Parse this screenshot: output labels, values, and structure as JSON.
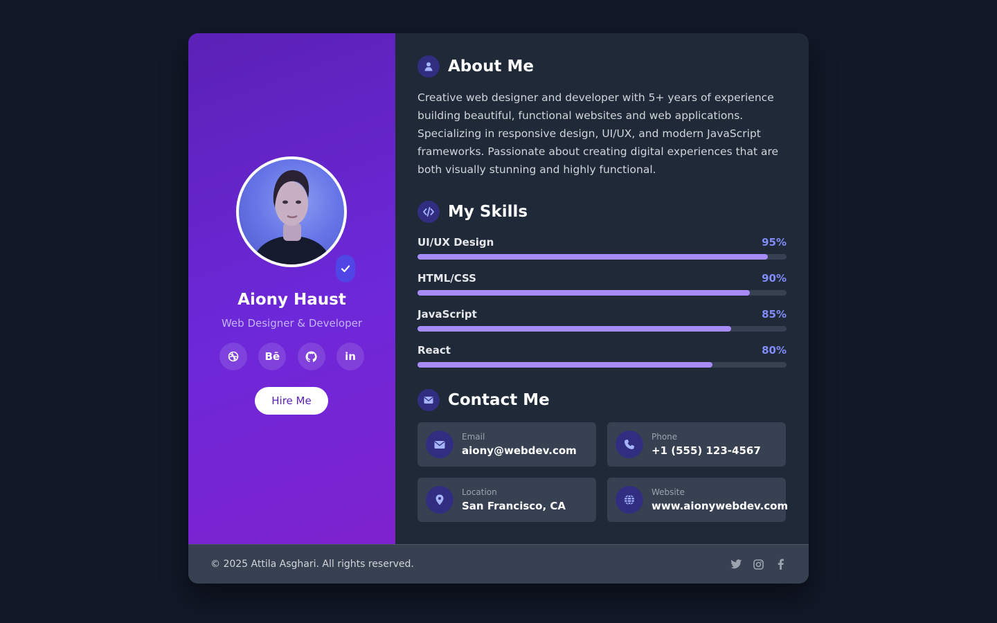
{
  "profile": {
    "name": "Aiony Haust",
    "role": "Web Designer & Developer",
    "hire_label": "Hire Me",
    "socials": [
      {
        "icon": "dribbble-icon",
        "glyph": ""
      },
      {
        "icon": "behance-icon",
        "glyph": "Bē"
      },
      {
        "icon": "github-icon",
        "glyph": ""
      },
      {
        "icon": "linkedin-icon",
        "glyph": "in"
      }
    ]
  },
  "about": {
    "title": "About Me",
    "text": "Creative web designer and developer with 5+ years of experience building beautiful, functional websites and web applications. Specializing in responsive design, UI/UX, and modern JavaScript frameworks. Passionate about creating digital experiences that are both visually stunning and highly functional."
  },
  "skills": {
    "title": "My Skills",
    "items": [
      {
        "name": "UI/UX Design",
        "pct": "95%",
        "value": 95
      },
      {
        "name": "HTML/CSS",
        "pct": "90%",
        "value": 90
      },
      {
        "name": "JavaScript",
        "pct": "85%",
        "value": 85
      },
      {
        "name": "React",
        "pct": "80%",
        "value": 80
      }
    ]
  },
  "contact": {
    "title": "Contact Me",
    "items": [
      {
        "label": "Email",
        "value": "aiony@webdev.com",
        "icon": "envelope-icon"
      },
      {
        "label": "Phone",
        "value": "+1 (555) 123-4567",
        "icon": "phone-icon"
      },
      {
        "label": "Location",
        "value": "San Francisco, CA",
        "icon": "location-pin-icon"
      },
      {
        "label": "Website",
        "value": "www.aionywebdev.com",
        "icon": "globe-icon"
      }
    ]
  },
  "footer": {
    "copyright": "© 2025 Attila Asghari. All rights reserved.",
    "icons": [
      "twitter-icon",
      "instagram-icon",
      "facebook-icon"
    ]
  },
  "colors": {
    "background": "#111827",
    "card": "#1f2937",
    "accent": "#a78bfa",
    "accent_text": "#818cf8",
    "sidebar_gradient": [
      "#5b21b6",
      "#7e22ce"
    ]
  }
}
